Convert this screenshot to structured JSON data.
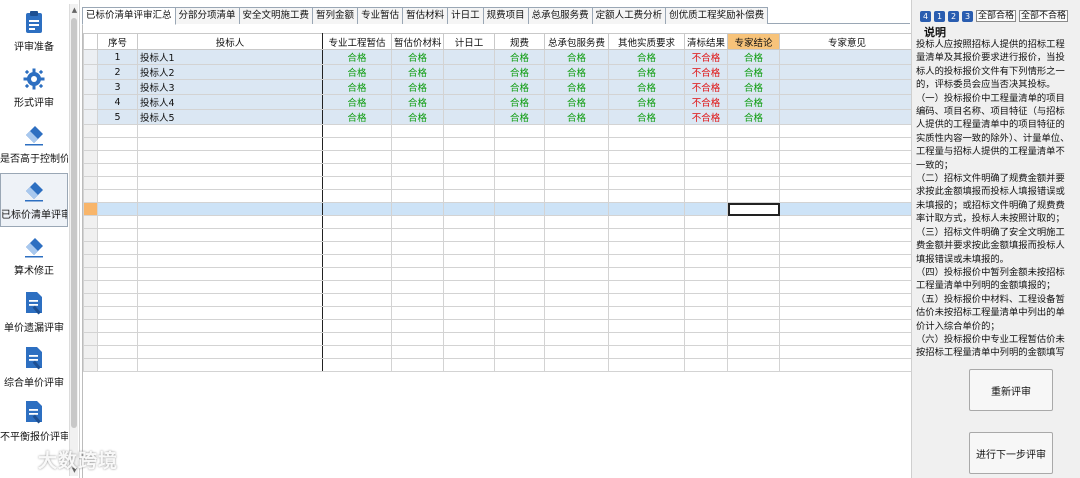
{
  "sidebar": {
    "items": [
      {
        "label": "评审准备",
        "icon": "clipboard-icon"
      },
      {
        "label": "形式评审",
        "icon": "gear-icon"
      },
      {
        "label": "是否高于控制价",
        "icon": "eraser-icon"
      },
      {
        "label": "已标价清单评审",
        "icon": "eraser-icon"
      },
      {
        "label": "算术修正",
        "icon": "eraser-icon"
      },
      {
        "label": "单价遗漏评审",
        "icon": "document-edit-icon"
      },
      {
        "label": "综合单价评审",
        "icon": "document-edit-icon"
      },
      {
        "label": "不平衡报价评审",
        "icon": "document-edit-icon"
      }
    ]
  },
  "tabs": [
    "已标价清单评审汇总",
    "分部分项清单",
    "安全文明施工费",
    "暂列金额",
    "专业暂估",
    "暂估材料",
    "计日工",
    "规费项目",
    "总承包服务费",
    "定额人工费分析",
    "创优质工程奖励补偿费"
  ],
  "grid": {
    "columns": [
      "序号",
      "投标人",
      "专业工程暂估",
      "暂估价材料",
      "计日工",
      "规费",
      "总承包服务费",
      "其他实质要求",
      "清标结果",
      "专家结论",
      "专家意见"
    ],
    "rows": [
      {
        "no": "1",
        "bidder": "投标人1",
        "c1": "合格",
        "c2": "合格",
        "c3": "",
        "c4": "合格",
        "c5": "合格",
        "c6": "合格",
        "result": "不合格",
        "conclusion": "合格",
        "opinion": ""
      },
      {
        "no": "2",
        "bidder": "投标人2",
        "c1": "合格",
        "c2": "合格",
        "c3": "",
        "c4": "合格",
        "c5": "合格",
        "c6": "合格",
        "result": "不合格",
        "conclusion": "合格",
        "opinion": ""
      },
      {
        "no": "3",
        "bidder": "投标人3",
        "c1": "合格",
        "c2": "合格",
        "c3": "",
        "c4": "合格",
        "c5": "合格",
        "c6": "合格",
        "result": "不合格",
        "conclusion": "合格",
        "opinion": ""
      },
      {
        "no": "4",
        "bidder": "投标人4",
        "c1": "合格",
        "c2": "合格",
        "c3": "",
        "c4": "合格",
        "c5": "合格",
        "c6": "合格",
        "result": "不合格",
        "conclusion": "合格",
        "opinion": ""
      },
      {
        "no": "5",
        "bidder": "投标人5",
        "c1": "合格",
        "c2": "合格",
        "c3": "",
        "c4": "合格",
        "c5": "合格",
        "c6": "合格",
        "result": "不合格",
        "conclusion": "合格",
        "opinion": ""
      }
    ],
    "empty_rows": 19,
    "selected_empty_row": 6,
    "colors": {
      "pass": "#0a9b0a",
      "fail": "#e01010",
      "expert_header": "#f7c37a",
      "data_row": "#dbe7f3",
      "selected_row": "#cde3f7"
    }
  },
  "right": {
    "levels": [
      "4",
      "1",
      "2",
      "3"
    ],
    "all_pass": "全部合格",
    "all_fail": "全部不合格",
    "title": "说明",
    "paragraphs": [
      "投标人应按照招标人提供的招标工程量清单及其报价要求进行报价，当投标人的投标报价文件有下列情形之一的，评标委员会应当否决其投标。",
      "（一）投标报价中工程量清单的项目编码、项目名称、项目特征（与招标人提供的工程量清单中的项目特征的实质性内容一致的除外）、计量单位、工程量与招标人提供的工程量清单不一致的；",
      "（二）招标文件明确了规费金额并要求按此金额填报而投标人填报错误或未填报的；或招标文件明确了规费费率计取方式，投标人未按照计取的；",
      "（三）招标文件明确了安全文明施工费金额并要求按此金额填报而投标人填报错误或未填报的。",
      "（四）投标报价中暂列金额未按招标工程量清单中列明的金额填报的；",
      "（五）投标报价中材料、工程设备暂估价未按招标工程量清单中列出的单价计入综合单价的；",
      "（六）投标报价中专业工程暂估价未按招标工程量清单中列明的金额填写"
    ],
    "reeval_label": "重新评审",
    "next_label": "进行下一步评审"
  },
  "watermark": "大数跨境"
}
